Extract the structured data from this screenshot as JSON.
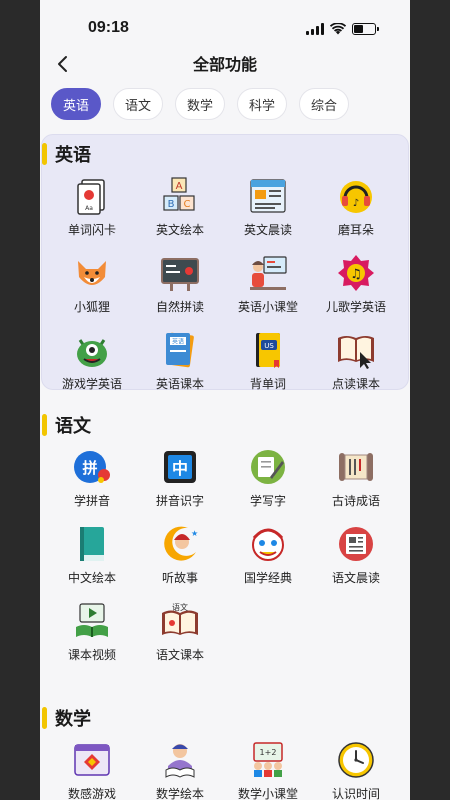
{
  "status": {
    "time": "09:18"
  },
  "nav": {
    "title": "全部功能"
  },
  "tabs": [
    "英语",
    "语文",
    "数学",
    "科学",
    "综合"
  ],
  "sections": {
    "english": {
      "title": "英语",
      "items": [
        {
          "label": "单词闪卡",
          "icon": "flashcard-icon"
        },
        {
          "label": "英文绘本",
          "icon": "abc-blocks-icon"
        },
        {
          "label": "英文晨读",
          "icon": "newspaper-icon"
        },
        {
          "label": "磨耳朵",
          "icon": "headphones-icon"
        },
        {
          "label": "小狐狸",
          "icon": "fox-icon"
        },
        {
          "label": "自然拼读",
          "icon": "blackboard-icon"
        },
        {
          "label": "英语小课堂",
          "icon": "teacher-icon"
        },
        {
          "label": "儿歌学英语",
          "icon": "music-note-icon"
        },
        {
          "label": "游戏学英语",
          "icon": "monster-icon"
        },
        {
          "label": "英语课本",
          "icon": "english-book-icon"
        },
        {
          "label": "背单词",
          "icon": "us-book-icon"
        },
        {
          "label": "点读课本",
          "icon": "open-book-cursor-icon"
        }
      ]
    },
    "chinese": {
      "title": "语文",
      "items": [
        {
          "label": "学拼音",
          "icon": "pinyin-icon"
        },
        {
          "label": "拼音识字",
          "icon": "zhong-char-icon"
        },
        {
          "label": "学写字",
          "icon": "pencil-writing-icon"
        },
        {
          "label": "古诗成语",
          "icon": "scroll-icon"
        },
        {
          "label": "中文绘本",
          "icon": "green-book-icon"
        },
        {
          "label": "听故事",
          "icon": "moon-story-icon"
        },
        {
          "label": "国学经典",
          "icon": "lion-dance-icon"
        },
        {
          "label": "语文晨读",
          "icon": "red-newspaper-icon"
        },
        {
          "label": "课本视频",
          "icon": "video-book-icon"
        },
        {
          "label": "语文课本",
          "icon": "yuwen-book-icon"
        }
      ]
    },
    "math": {
      "title": "数学",
      "items": [
        {
          "label": "数感游戏",
          "icon": "math-game-icon"
        },
        {
          "label": "数学绘本",
          "icon": "reading-kid-icon"
        },
        {
          "label": "数学小课堂",
          "icon": "math-board-icon"
        },
        {
          "label": "认识时间",
          "icon": "clock-icon"
        }
      ]
    }
  }
}
